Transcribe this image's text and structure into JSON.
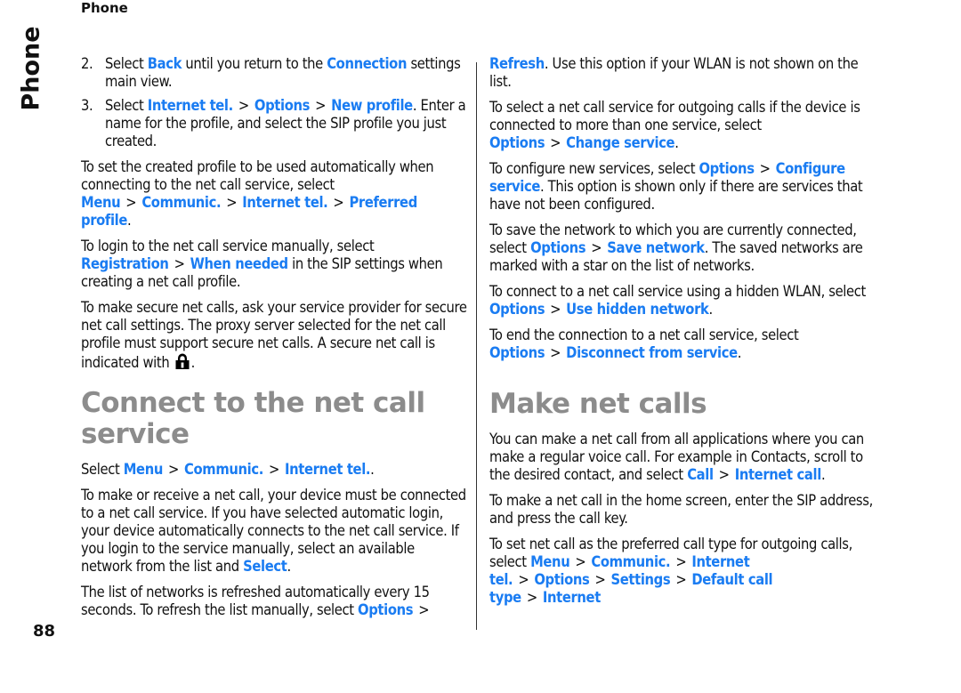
{
  "header": {
    "running_head": "Phone",
    "side_tab": "Phone",
    "page_number": "88"
  },
  "left": {
    "step2": {
      "num": "2.",
      "t1": "Select ",
      "l1": "Back",
      "t2": " until you return to the ",
      "l2": "Connection",
      "t3": " settings main view."
    },
    "step3": {
      "num": "3.",
      "t1": "Select ",
      "l1": "Internet tel.",
      "sep1": ">",
      "l2": "Options",
      "sep2": ">",
      "l3": "New profile",
      "t2": ". Enter a name for the profile, and select the SIP profile you just created."
    },
    "p_auto": {
      "t1": "To set the created profile to be used automatically when connecting to the net call service, select ",
      "l1": "Menu",
      "sep1": ">",
      "l2": "Communic.",
      "sep2": ">",
      "l3": "Internet tel.",
      "sep3": ">",
      "l4": "Preferred profile",
      "t2": "."
    },
    "p_login": {
      "t1": "To login to the net call service manually, select ",
      "l1": "Registration",
      "sep1": ">",
      "l2": "When needed",
      "t2": " in the SIP settings when creating a net call profile."
    },
    "p_secure": {
      "t1": "To make secure net calls, ask your service provider for secure net call settings. The proxy server selected for the net call profile must support secure net calls. A secure net call is indicated with ",
      "icon": "lock-icon",
      "t2": "."
    },
    "heading": "Connect to the net call service",
    "p_select": {
      "t1": "Select ",
      "l1": "Menu",
      "sep1": ">",
      "l2": "Communic.",
      "sep2": ">",
      "l3": "Internet tel.",
      "t2": "."
    },
    "p_connect": {
      "t1": "To make or receive a net call, your device must be connected to a net call service. If you have selected automatic login, your device automatically connects to the net call service. If you login to the service manually, select an available network from the list and ",
      "l1": "Select",
      "t2": "."
    },
    "p_list": {
      "t1": "The list of networks is refreshed automatically every 15 seconds. To refresh the list manually, select ",
      "l1": "Options",
      "sep1": ">"
    }
  },
  "right": {
    "p_refresh": {
      "l1": "Refresh",
      "t1": ". Use this option if your WLAN is not shown on the list."
    },
    "p_change": {
      "t1": "To select a net call service for outgoing calls if the device is connected to more than one service, select ",
      "l1": "Options",
      "sep1": ">",
      "l2": "Change service",
      "t2": "."
    },
    "p_configure": {
      "t1": "To configure new services, select ",
      "l1": "Options",
      "sep1": ">",
      "l2": "Configure service",
      "t2": ". This option is shown only if there are services that have not been configured."
    },
    "p_save": {
      "t1": "To save the network to which you are currently connected, select ",
      "l1": "Options",
      "sep1": ">",
      "l2": "Save network",
      "t2": ". The saved networks are marked with a star on the list of networks."
    },
    "p_hidden": {
      "t1": "To connect to a net call service using a hidden WLAN, select ",
      "l1": "Options",
      "sep1": ">",
      "l2": "Use hidden network",
      "t2": "."
    },
    "p_end": {
      "t1": "To end the connection to a net call service, select ",
      "l1": "Options",
      "sep1": ">",
      "l2": "Disconnect from service",
      "t2": "."
    },
    "heading": "Make net calls",
    "p_make": {
      "t1": "You can make a net call from all applications where you can make a regular voice call. For example in Contacts, scroll to the desired contact, and select ",
      "l1": "Call",
      "sep1": ">",
      "l2": "Internet call",
      "t2": "."
    },
    "p_home": {
      "t1": "To make a net call in the home screen, enter the SIP address, and press the call key."
    },
    "p_pref": {
      "t1": "To set net call as the preferred call type for outgoing calls, select ",
      "l1": "Menu",
      "sep1": ">",
      "l2": "Communic.",
      "sep2": ">",
      "l3": "Internet tel.",
      "sep3": ">",
      "l4": "Options",
      "sep4": ">",
      "l5": "Settings",
      "sep5": ">",
      "l6": "Default call type",
      "sep6": ">",
      "l7": "Internet"
    }
  }
}
